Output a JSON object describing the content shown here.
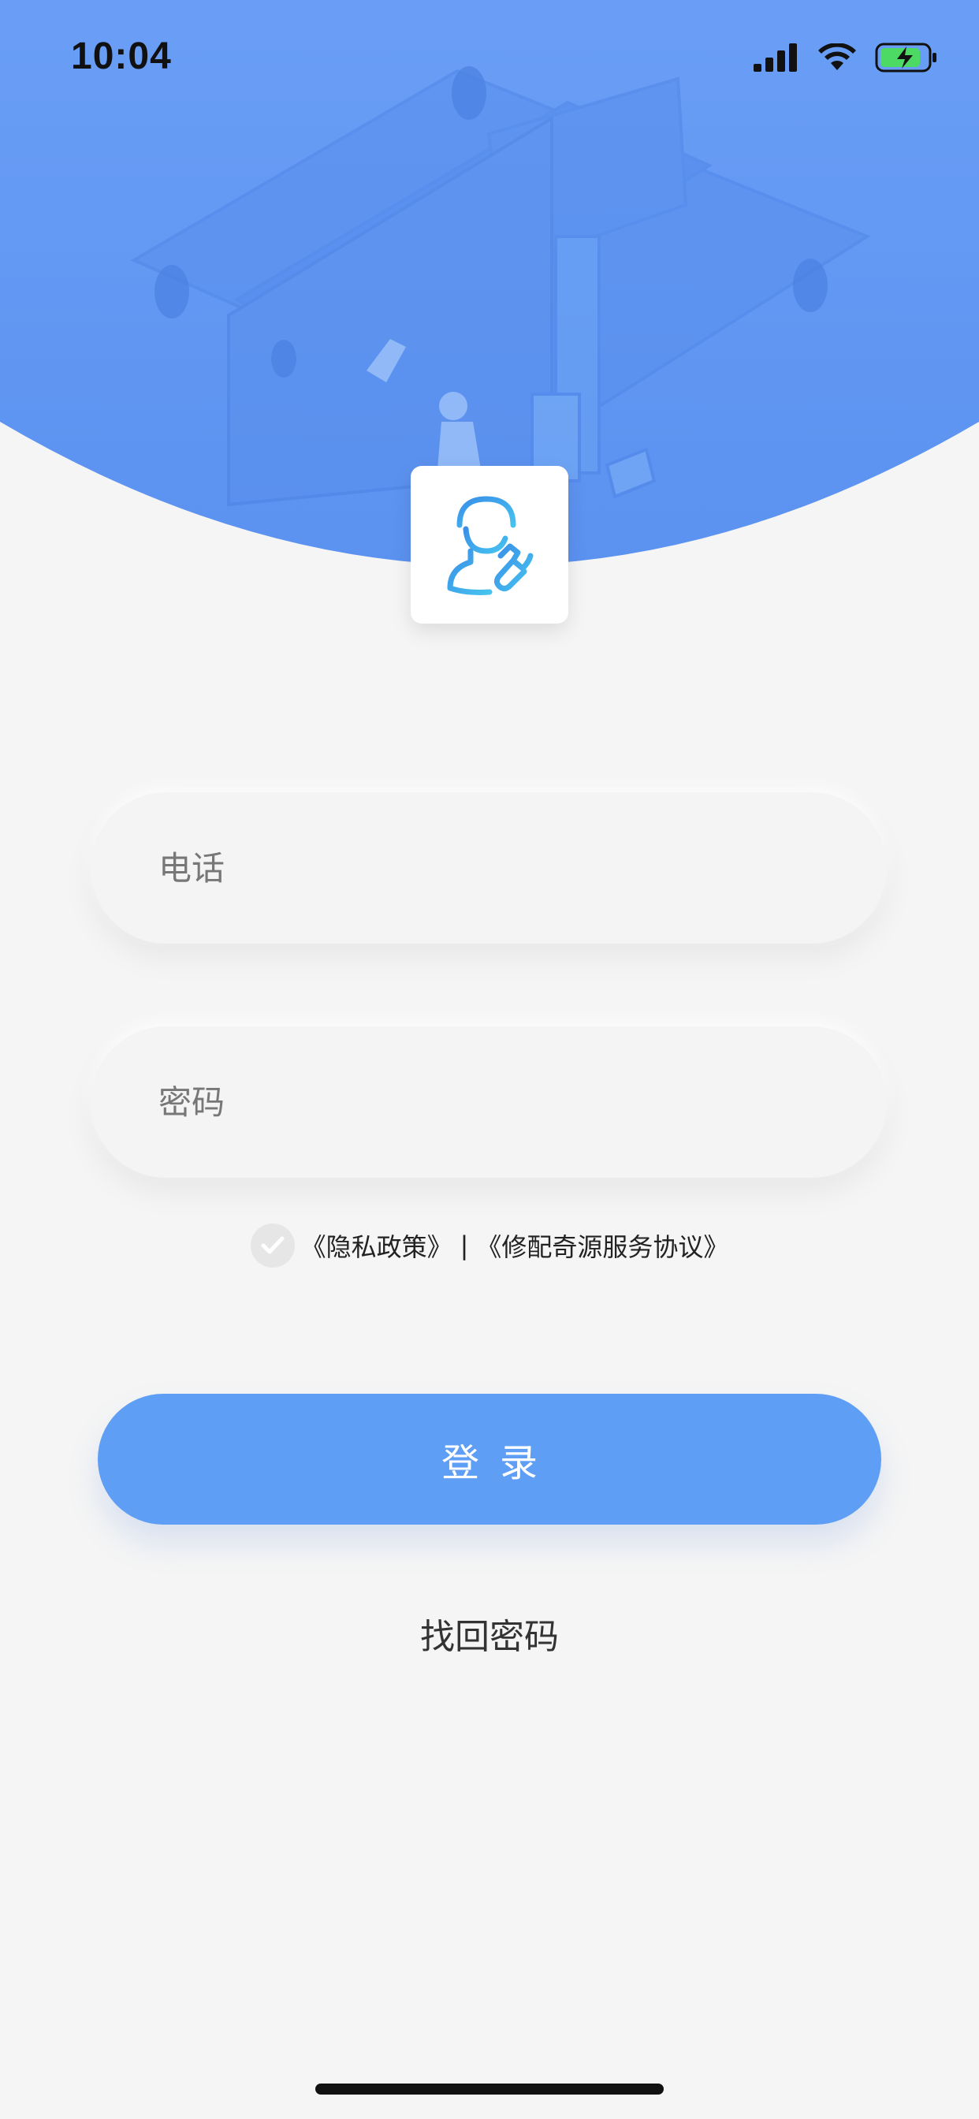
{
  "status_bar": {
    "time": "10:04"
  },
  "colors": {
    "brand_blue": "#5f9ef5",
    "hero_blue": "#6399f4",
    "background": "#f5f5f5"
  },
  "logo": {
    "icon": "worker-with-wrench-icon"
  },
  "form": {
    "phone_placeholder": "电话",
    "password_placeholder": "密码",
    "phone_value": "",
    "password_value": ""
  },
  "agreement": {
    "checked": true,
    "privacy_policy": "《隐私政策》",
    "separator": "|",
    "service_agreement": "《修配奇源服务协议》"
  },
  "actions": {
    "login_label": "登录",
    "forgot_password_label": "找回密码"
  }
}
